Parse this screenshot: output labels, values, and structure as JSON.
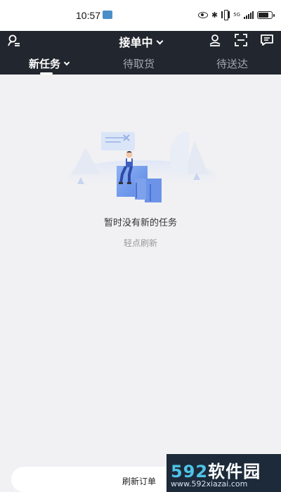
{
  "status_bar": {
    "time": "10:57",
    "network": "5G",
    "bluetooth_symbol": "✱"
  },
  "header": {
    "title": "接单中",
    "icons": [
      "user-list-icon",
      "location-user-icon",
      "scan-icon",
      "message-icon"
    ]
  },
  "tabs": [
    {
      "label": "新任务",
      "active": true
    },
    {
      "label": "待取货",
      "active": false
    },
    {
      "label": "待送达",
      "active": false
    }
  ],
  "empty_state": {
    "message": "暂时没有新的任务",
    "action": "轻点刷新"
  },
  "bottom": {
    "refresh_orders": "刷新订单"
  },
  "watermark": {
    "logo_main": "592",
    "logo_sub": "软件园",
    "url": "www.592xiazai.com"
  },
  "colors": {
    "header_bg": "#22262e",
    "page_bg": "#f1f1f3",
    "accent_blue": "#4a7fe0"
  }
}
